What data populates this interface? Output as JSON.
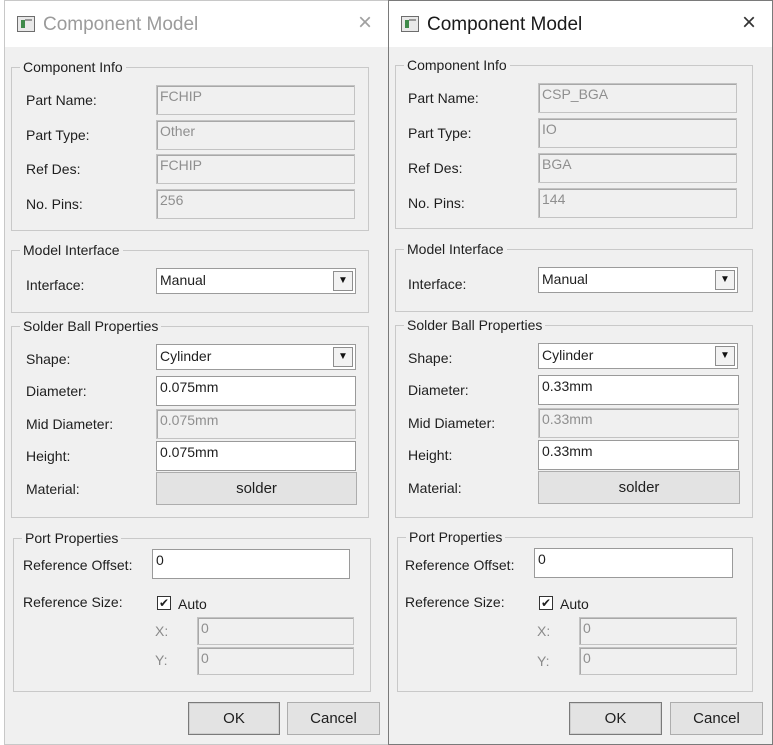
{
  "dialogs": [
    {
      "title": "Component Model",
      "close_icon": "×",
      "component_info": {
        "legend": "Component Info",
        "part_name_label": "Part Name:",
        "part_name": "FCHIP",
        "part_type_label": "Part Type:",
        "part_type": "Other",
        "ref_des_label": "Ref Des:",
        "ref_des": "FCHIP",
        "no_pins_label": "No. Pins:",
        "no_pins": "256"
      },
      "model_interface": {
        "legend": "Model Interface",
        "interface_label": "Interface:",
        "interface_value": "Manual"
      },
      "solder_ball": {
        "legend": "Solder Ball Properties",
        "shape_label": "Shape:",
        "shape_value": "Cylinder",
        "diameter_label": "Diameter:",
        "diameter": "0.075mm",
        "mid_diameter_label": "Mid Diameter:",
        "mid_diameter": "0.075mm",
        "height_label": "Height:",
        "height": "0.075mm",
        "material_label": "Material:",
        "material": "solder"
      },
      "port": {
        "legend": "Port Properties",
        "ref_offset_label": "Reference Offset:",
        "ref_offset": "0",
        "ref_size_label": "Reference Size:",
        "auto_label": "Auto",
        "auto_checked": true,
        "check_mark": "✔",
        "x_label": "X:",
        "x_value": "0",
        "y_label": "Y:",
        "y_value": "0"
      },
      "ok": "OK",
      "cancel": "Cancel"
    },
    {
      "title": "Component Model",
      "close_icon": "×",
      "component_info": {
        "legend": "Component Info",
        "part_name_label": "Part Name:",
        "part_name": "CSP_BGA",
        "part_type_label": "Part Type:",
        "part_type": "IO",
        "ref_des_label": "Ref Des:",
        "ref_des": "BGA",
        "no_pins_label": "No. Pins:",
        "no_pins": "144"
      },
      "model_interface": {
        "legend": "Model Interface",
        "interface_label": "Interface:",
        "interface_value": "Manual"
      },
      "solder_ball": {
        "legend": "Solder Ball Properties",
        "shape_label": "Shape:",
        "shape_value": "Cylinder",
        "diameter_label": "Diameter:",
        "diameter": "0.33mm",
        "mid_diameter_label": "Mid Diameter:",
        "mid_diameter": "0.33mm",
        "height_label": "Height:",
        "height": "0.33mm",
        "material_label": "Material:",
        "material": "solder"
      },
      "port": {
        "legend": "Port Properties",
        "ref_offset_label": "Reference Offset:",
        "ref_offset": "0",
        "ref_size_label": "Reference Size:",
        "auto_label": "Auto",
        "auto_checked": true,
        "check_mark": "✔",
        "x_label": "X:",
        "x_value": "0",
        "y_label": "Y:",
        "y_value": "0"
      },
      "ok": "OK",
      "cancel": "Cancel"
    }
  ]
}
